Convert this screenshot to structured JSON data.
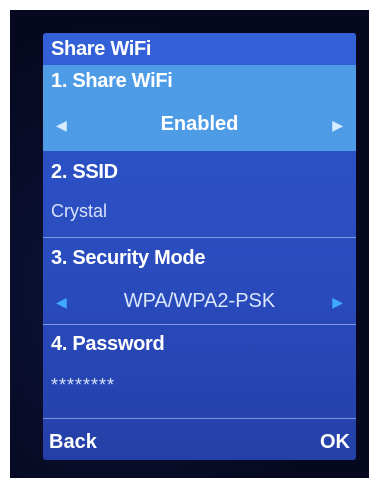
{
  "screen": {
    "title": "Share WiFi"
  },
  "items": [
    {
      "label": "1. Share WiFi",
      "value": "Enabled",
      "has_arrows": true,
      "selected": true
    },
    {
      "label": "2. SSID",
      "value": "Crystal"
    },
    {
      "label": "3. Security Mode",
      "value": "WPA/WPA2-PSK",
      "has_arrows": true
    },
    {
      "label": "4. Password",
      "value": "********"
    }
  ],
  "softkeys": {
    "left": "Back",
    "right": "OK"
  },
  "icons": {
    "left_arrow": "left-triangle-icon",
    "right_arrow": "right-triangle-icon"
  },
  "colors": {
    "screen_background": "#2b4fc2",
    "title_bar": "#3360d6",
    "selection_highlight": "#4f9ce6",
    "arrow_blue": "#3fa8ff"
  }
}
